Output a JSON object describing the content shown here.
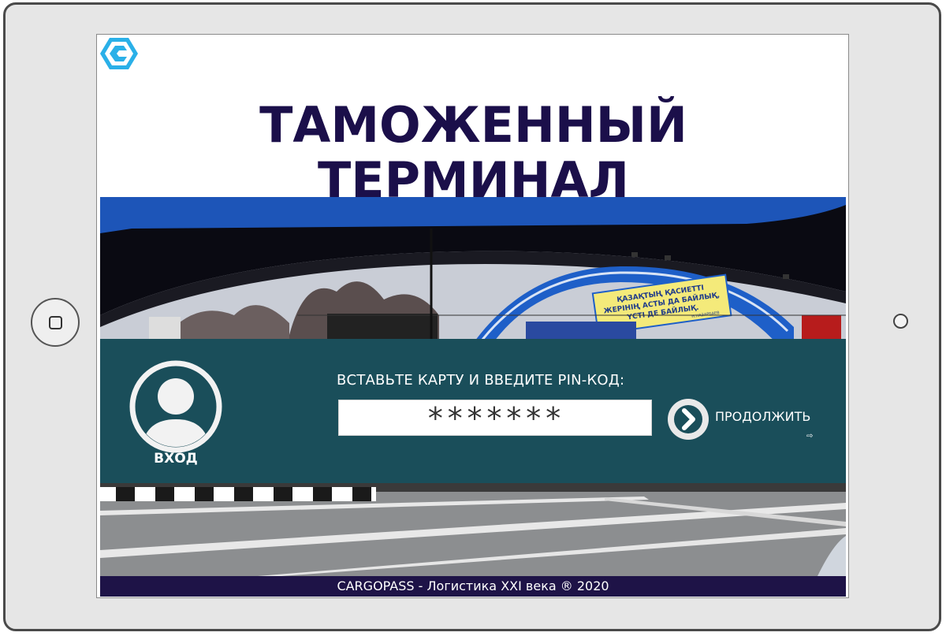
{
  "screen": {
    "title": "ТАМОЖЕННЫЙ ТЕРМИНАЛ",
    "logo_icon": "cargopass-logo-icon"
  },
  "photo": {
    "arch_sign_line1": "ҚАЗАҚТЫҢ ҚАСИЕТТІ",
    "arch_sign_line2": "ЖЕРІНІҢ АСТЫ ДА БАЙЛЫҚ,",
    "arch_sign_line3": "ҮСТІ ДЕ БАЙЛЫҚ.",
    "arch_sign_author": "Н.НАЗАРБАЕВ"
  },
  "login": {
    "avatar_icon": "user-avatar-icon",
    "avatar_label": "ВХОД",
    "pin_prompt": "ВСТАВЬТЕ КАРТУ И ВВЕДИТЕ PIN-КОД:",
    "pin_value": "*******",
    "continue_icon": "chevron-right-icon",
    "continue_label": "ПРОДОЛЖИТЬ",
    "small_arrow": "⇨"
  },
  "footer": {
    "text": "CARGOPASS - Логистика XXI века ® 2020"
  },
  "colors": {
    "title": "#1b0f4a",
    "band": "#1a4e5a",
    "footer": "#1e1347",
    "arch_blue": "#1e5fc8"
  }
}
